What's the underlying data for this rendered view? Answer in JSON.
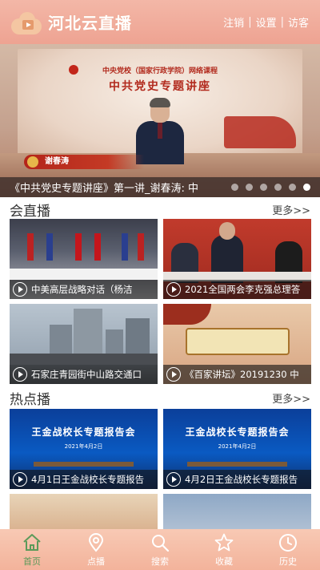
{
  "header": {
    "app_title": "河北云直播",
    "links": [
      "注销",
      "设置",
      "访客"
    ],
    "separator": "|"
  },
  "banner": {
    "line1": "中央党校（国家行政学院）网络课程",
    "line2": "中共党史专题讲座",
    "speaker": "谢春涛",
    "caption": "《中共党史专题讲座》第一讲_谢春涛: 中",
    "slide_count": 6,
    "active_slide": 6
  },
  "live_section": {
    "title": "会直播",
    "more": "更多>>",
    "items": [
      {
        "caption": "中美高层战略对话（杨洁"
      },
      {
        "caption": "2021全国两会李克强总理答"
      },
      {
        "caption": "石家庄青园街中山路交通口"
      },
      {
        "caption": "《百家讲坛》20191230 中"
      }
    ]
  },
  "hot_section": {
    "title": "热点播",
    "more": "更多>>",
    "items": [
      {
        "caption": "4月1日王金战校长专题报告",
        "slide_title": "王金战校长专题报告会",
        "slide_date": "2021年4月2日"
      },
      {
        "caption": "4月2日王金战校长专题报告",
        "slide_title": "王金战校长专题报告会",
        "slide_date": "2021年4月2日"
      }
    ]
  },
  "bottom_nav": {
    "items": [
      {
        "label": "首页",
        "icon": "home-icon"
      },
      {
        "label": "点播",
        "icon": "location-pin-icon"
      },
      {
        "label": "搜索",
        "icon": "search-icon"
      },
      {
        "label": "收藏",
        "icon": "star-icon"
      },
      {
        "label": "历史",
        "icon": "clock-icon"
      }
    ],
    "active_index": 0
  },
  "colors": {
    "header_bg": "#eea392",
    "nav_bg": "#f3b39b",
    "nav_active": "#5c9a5a"
  }
}
